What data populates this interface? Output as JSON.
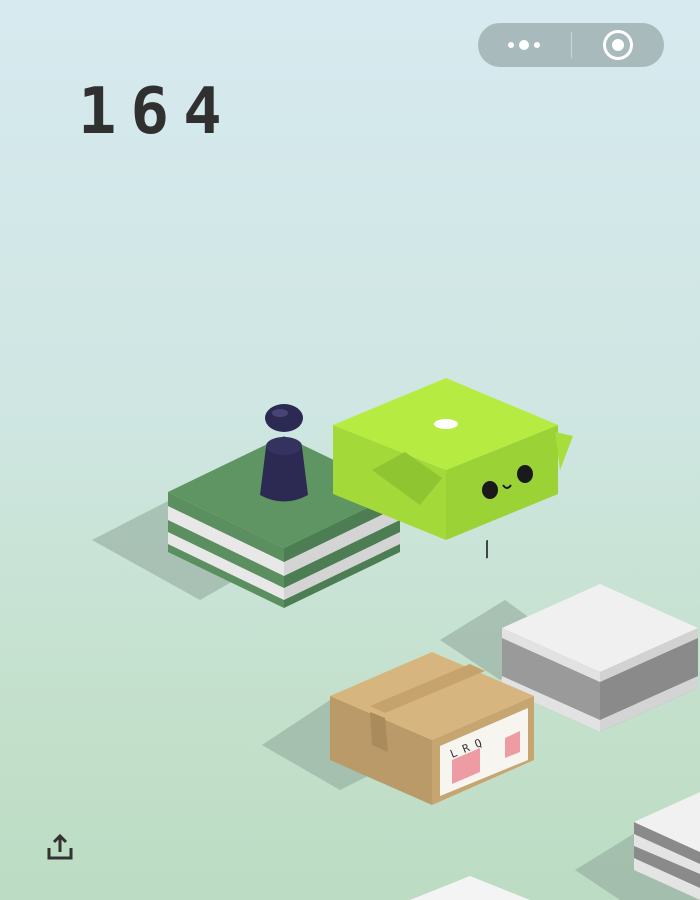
{
  "hud": {
    "score": "164",
    "menu_icon": "more-dots-icon",
    "close_icon": "target-circle-icon",
    "share_icon": "share-upload-icon"
  },
  "game": {
    "platforms": [
      {
        "name": "green-striped-platform",
        "type": "cube-striped",
        "color": "#5e9562",
        "stripe": "#e6e6e6"
      },
      {
        "name": "lime-face-box",
        "type": "lime-box",
        "color": "#b6ec42"
      },
      {
        "name": "grey-striped-platform",
        "type": "cube-striped",
        "color": "#f0f0f0",
        "stripe": "#8e8e8e"
      },
      {
        "name": "cardboard-box",
        "type": "cardboard",
        "color": "#d7b57e",
        "label_text": "L R Q"
      },
      {
        "name": "grey-platform-edge",
        "type": "cube-striped",
        "color": "#f1f1f1",
        "stripe": "#7c7c7c"
      },
      {
        "name": "white-platform-edge",
        "type": "plain",
        "color": "#f4f4f4"
      }
    ],
    "player": {
      "name": "player-piece",
      "color": "#2c2a52"
    }
  }
}
